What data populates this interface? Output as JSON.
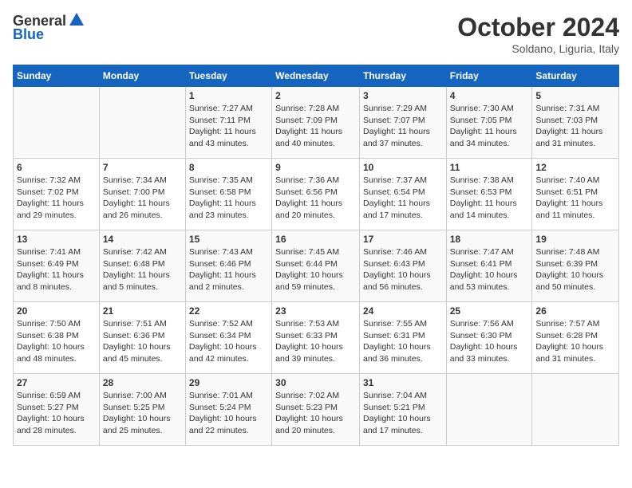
{
  "header": {
    "logo_general": "General",
    "logo_blue": "Blue",
    "month_title": "October 2024",
    "subtitle": "Soldano, Liguria, Italy"
  },
  "days_of_week": [
    "Sunday",
    "Monday",
    "Tuesday",
    "Wednesday",
    "Thursday",
    "Friday",
    "Saturday"
  ],
  "weeks": [
    [
      {
        "day": "",
        "sunrise": "",
        "sunset": "",
        "daylight": ""
      },
      {
        "day": "",
        "sunrise": "",
        "sunset": "",
        "daylight": ""
      },
      {
        "day": "1",
        "sunrise": "Sunrise: 7:27 AM",
        "sunset": "Sunset: 7:11 PM",
        "daylight": "Daylight: 11 hours and 43 minutes."
      },
      {
        "day": "2",
        "sunrise": "Sunrise: 7:28 AM",
        "sunset": "Sunset: 7:09 PM",
        "daylight": "Daylight: 11 hours and 40 minutes."
      },
      {
        "day": "3",
        "sunrise": "Sunrise: 7:29 AM",
        "sunset": "Sunset: 7:07 PM",
        "daylight": "Daylight: 11 hours and 37 minutes."
      },
      {
        "day": "4",
        "sunrise": "Sunrise: 7:30 AM",
        "sunset": "Sunset: 7:05 PM",
        "daylight": "Daylight: 11 hours and 34 minutes."
      },
      {
        "day": "5",
        "sunrise": "Sunrise: 7:31 AM",
        "sunset": "Sunset: 7:03 PM",
        "daylight": "Daylight: 11 hours and 31 minutes."
      }
    ],
    [
      {
        "day": "6",
        "sunrise": "Sunrise: 7:32 AM",
        "sunset": "Sunset: 7:02 PM",
        "daylight": "Daylight: 11 hours and 29 minutes."
      },
      {
        "day": "7",
        "sunrise": "Sunrise: 7:34 AM",
        "sunset": "Sunset: 7:00 PM",
        "daylight": "Daylight: 11 hours and 26 minutes."
      },
      {
        "day": "8",
        "sunrise": "Sunrise: 7:35 AM",
        "sunset": "Sunset: 6:58 PM",
        "daylight": "Daylight: 11 hours and 23 minutes."
      },
      {
        "day": "9",
        "sunrise": "Sunrise: 7:36 AM",
        "sunset": "Sunset: 6:56 PM",
        "daylight": "Daylight: 11 hours and 20 minutes."
      },
      {
        "day": "10",
        "sunrise": "Sunrise: 7:37 AM",
        "sunset": "Sunset: 6:54 PM",
        "daylight": "Daylight: 11 hours and 17 minutes."
      },
      {
        "day": "11",
        "sunrise": "Sunrise: 7:38 AM",
        "sunset": "Sunset: 6:53 PM",
        "daylight": "Daylight: 11 hours and 14 minutes."
      },
      {
        "day": "12",
        "sunrise": "Sunrise: 7:40 AM",
        "sunset": "Sunset: 6:51 PM",
        "daylight": "Daylight: 11 hours and 11 minutes."
      }
    ],
    [
      {
        "day": "13",
        "sunrise": "Sunrise: 7:41 AM",
        "sunset": "Sunset: 6:49 PM",
        "daylight": "Daylight: 11 hours and 8 minutes."
      },
      {
        "day": "14",
        "sunrise": "Sunrise: 7:42 AM",
        "sunset": "Sunset: 6:48 PM",
        "daylight": "Daylight: 11 hours and 5 minutes."
      },
      {
        "day": "15",
        "sunrise": "Sunrise: 7:43 AM",
        "sunset": "Sunset: 6:46 PM",
        "daylight": "Daylight: 11 hours and 2 minutes."
      },
      {
        "day": "16",
        "sunrise": "Sunrise: 7:45 AM",
        "sunset": "Sunset: 6:44 PM",
        "daylight": "Daylight: 10 hours and 59 minutes."
      },
      {
        "day": "17",
        "sunrise": "Sunrise: 7:46 AM",
        "sunset": "Sunset: 6:43 PM",
        "daylight": "Daylight: 10 hours and 56 minutes."
      },
      {
        "day": "18",
        "sunrise": "Sunrise: 7:47 AM",
        "sunset": "Sunset: 6:41 PM",
        "daylight": "Daylight: 10 hours and 53 minutes."
      },
      {
        "day": "19",
        "sunrise": "Sunrise: 7:48 AM",
        "sunset": "Sunset: 6:39 PM",
        "daylight": "Daylight: 10 hours and 50 minutes."
      }
    ],
    [
      {
        "day": "20",
        "sunrise": "Sunrise: 7:50 AM",
        "sunset": "Sunset: 6:38 PM",
        "daylight": "Daylight: 10 hours and 48 minutes."
      },
      {
        "day": "21",
        "sunrise": "Sunrise: 7:51 AM",
        "sunset": "Sunset: 6:36 PM",
        "daylight": "Daylight: 10 hours and 45 minutes."
      },
      {
        "day": "22",
        "sunrise": "Sunrise: 7:52 AM",
        "sunset": "Sunset: 6:34 PM",
        "daylight": "Daylight: 10 hours and 42 minutes."
      },
      {
        "day": "23",
        "sunrise": "Sunrise: 7:53 AM",
        "sunset": "Sunset: 6:33 PM",
        "daylight": "Daylight: 10 hours and 39 minutes."
      },
      {
        "day": "24",
        "sunrise": "Sunrise: 7:55 AM",
        "sunset": "Sunset: 6:31 PM",
        "daylight": "Daylight: 10 hours and 36 minutes."
      },
      {
        "day": "25",
        "sunrise": "Sunrise: 7:56 AM",
        "sunset": "Sunset: 6:30 PM",
        "daylight": "Daylight: 10 hours and 33 minutes."
      },
      {
        "day": "26",
        "sunrise": "Sunrise: 7:57 AM",
        "sunset": "Sunset: 6:28 PM",
        "daylight": "Daylight: 10 hours and 31 minutes."
      }
    ],
    [
      {
        "day": "27",
        "sunrise": "Sunrise: 6:59 AM",
        "sunset": "Sunset: 5:27 PM",
        "daylight": "Daylight: 10 hours and 28 minutes."
      },
      {
        "day": "28",
        "sunrise": "Sunrise: 7:00 AM",
        "sunset": "Sunset: 5:25 PM",
        "daylight": "Daylight: 10 hours and 25 minutes."
      },
      {
        "day": "29",
        "sunrise": "Sunrise: 7:01 AM",
        "sunset": "Sunset: 5:24 PM",
        "daylight": "Daylight: 10 hours and 22 minutes."
      },
      {
        "day": "30",
        "sunrise": "Sunrise: 7:02 AM",
        "sunset": "Sunset: 5:23 PM",
        "daylight": "Daylight: 10 hours and 20 minutes."
      },
      {
        "day": "31",
        "sunrise": "Sunrise: 7:04 AM",
        "sunset": "Sunset: 5:21 PM",
        "daylight": "Daylight: 10 hours and 17 minutes."
      },
      {
        "day": "",
        "sunrise": "",
        "sunset": "",
        "daylight": ""
      },
      {
        "day": "",
        "sunrise": "",
        "sunset": "",
        "daylight": ""
      }
    ]
  ]
}
